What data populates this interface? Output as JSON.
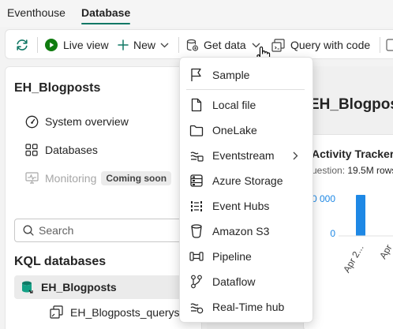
{
  "tabs": [
    {
      "label": "Eventhouse",
      "active": false
    },
    {
      "label": "Database",
      "active": true
    }
  ],
  "toolbar": {
    "refresh_icon": "refresh-icon",
    "live_view_label": "Live view",
    "new_label": "New",
    "get_data_label": "Get data",
    "query_with_code_label": "Query with code"
  },
  "left_panel": {
    "title": "EH_Blogposts",
    "nav": [
      {
        "label": "System overview",
        "icon": "gauge-icon"
      },
      {
        "label": "Databases",
        "icon": "grid-icon"
      },
      {
        "label": "Monitoring",
        "icon": "monitor-icon",
        "badge": "Coming soon",
        "disabled": true
      }
    ],
    "search_placeholder": "Search",
    "kql_header": "KQL databases",
    "db_item": "EH_Blogposts",
    "queryset_item": "EH_Blogposts_queryset"
  },
  "main": {
    "title": "EH_Blogposts",
    "card": {
      "title": "Activity Tracker",
      "subtitle_prefix": "uestion: ",
      "subtitle_value": "19.5M rows",
      "chart_data": {
        "type": "bar",
        "y_ticks": [
          "0 000",
          "0"
        ],
        "x_ticks": [
          "Apr 2...",
          "Apr"
        ]
      }
    }
  },
  "menu": {
    "items": [
      {
        "label": "Sample",
        "icon": "flag-icon"
      },
      {
        "label": "Local file",
        "icon": "file-icon"
      },
      {
        "label": "OneLake",
        "icon": "folder-icon"
      },
      {
        "label": "Eventstream",
        "icon": "eventstream-icon",
        "submenu": true
      },
      {
        "label": "Azure Storage",
        "icon": "storage-icon"
      },
      {
        "label": "Event Hubs",
        "icon": "event-hubs-icon"
      },
      {
        "label": "Amazon S3",
        "icon": "bucket-icon"
      },
      {
        "label": "Pipeline",
        "icon": "pipeline-icon"
      },
      {
        "label": "Dataflow",
        "icon": "dataflow-icon"
      },
      {
        "label": "Real-Time hub",
        "icon": "realtime-hub-icon"
      }
    ]
  },
  "colors": {
    "accent": "#117865",
    "live_green": "#107c10",
    "bar_blue": "#1e88e5",
    "db_icon_green": "#0e7a66"
  }
}
